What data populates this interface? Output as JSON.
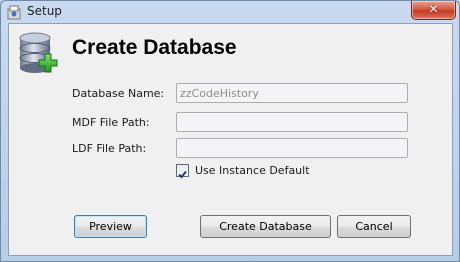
{
  "window": {
    "title": "Setup",
    "close_symbol": "✕"
  },
  "header": {
    "title": "Create Database",
    "icon": "database-add-icon"
  },
  "form": {
    "database_name": {
      "label": "Database Name:",
      "value": "zzCodeHistory"
    },
    "mdf_path": {
      "label": "MDF File Path:",
      "value": ""
    },
    "ldf_path": {
      "label": "LDF File Path:",
      "value": ""
    },
    "use_instance_default": {
      "label": "Use Instance Default",
      "checked": true
    }
  },
  "buttons": {
    "preview": "Preview",
    "create": "Create Database",
    "cancel": "Cancel"
  },
  "colors": {
    "titlebar": "#b9d1ea",
    "client": "#f0f0f0",
    "close": "#c43b22",
    "default_button_border": "#3c7fb1"
  }
}
